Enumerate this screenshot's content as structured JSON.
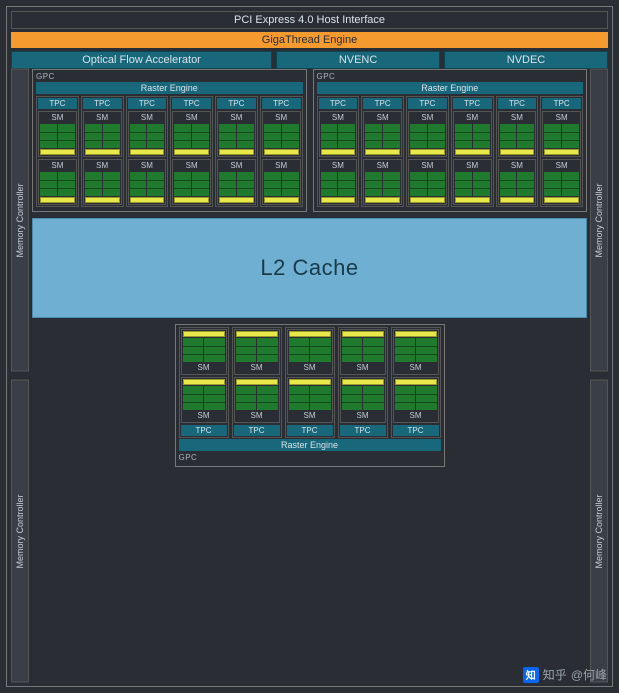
{
  "header": {
    "pci": "PCI Express 4.0 Host Interface",
    "gigathread": "GigaThread Engine",
    "ofa": "Optical Flow Accelerator",
    "nvenc": "NVENC",
    "nvdec": "NVDEC"
  },
  "labels": {
    "memController": "Memory Controller",
    "gpc": "GPC",
    "raster": "Raster Engine",
    "tpc": "TPC",
    "sm": "SM",
    "l2": "L2 Cache"
  },
  "layout": {
    "topGpcCount": 2,
    "tpcsPerTopGpc": 6,
    "smsPerTpc": 2,
    "bottomGpcTpcCount": 5,
    "memControllersPerSide": 2
  },
  "colors": {
    "accentTeal": "#18677a",
    "accentOrange": "#f59a2f",
    "coreGreen": "#207a2e",
    "tensorYellow": "#e8e84b",
    "l2Blue": "#6fb0d2",
    "bg": "#2a2d33"
  },
  "watermark": {
    "site": "知乎",
    "author": "@何峰",
    "logo": "知"
  }
}
